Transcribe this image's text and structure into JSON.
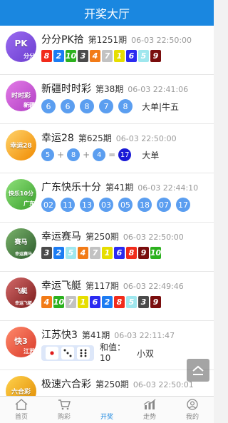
{
  "header": {
    "title": "开奖大厅"
  },
  "lotteries": [
    {
      "name": "分分PK拾",
      "issue": "第1251期",
      "time": "06-03 22:50:00",
      "logo": {
        "text": "PK",
        "badge": "分分",
        "color": "#7c4dd8"
      },
      "numbers": [
        "8",
        "2",
        "10",
        "3",
        "4",
        "7",
        "1",
        "6",
        "5",
        "9"
      ]
    },
    {
      "name": "新疆时时彩",
      "issue": "第38期",
      "time": "06-03 22:41:06",
      "logo": {
        "text": "时时彩",
        "badge": "新疆",
        "color": "#d25ad8"
      },
      "numbers": [
        "6",
        "6",
        "8",
        "7",
        "8"
      ],
      "result": "大单|牛五"
    },
    {
      "name": "幸运28",
      "issue": "第625期",
      "time": "06-03 22:50:00",
      "logo": {
        "text": "幸运28",
        "badge": "",
        "color": "#f0a020"
      },
      "numbers": [
        "5",
        "8",
        "4"
      ],
      "sum": "17",
      "result": "大单"
    },
    {
      "name": "广东快乐十分",
      "issue": "第41期",
      "time": "06-03 22:44:10",
      "logo": {
        "text": "快乐10分",
        "badge": "广东",
        "color": "#57c14b"
      },
      "numbers": [
        "02",
        "11",
        "13",
        "03",
        "05",
        "18",
        "07",
        "17"
      ]
    },
    {
      "name": "幸运赛马",
      "issue": "第250期",
      "time": "06-03 22:50:00",
      "logo": {
        "text": "赛马",
        "badge": "幸运赛马",
        "color": "#3a7f3a"
      },
      "numbers": [
        "3",
        "2",
        "5",
        "4",
        "7",
        "1",
        "6",
        "8",
        "9",
        "10"
      ]
    },
    {
      "name": "幸运飞艇",
      "issue": "第117期",
      "time": "06-03 22:49:46",
      "logo": {
        "text": "飞艇",
        "badge": "幸运飞艇",
        "color": "#b33"
      },
      "numbers": [
        "4",
        "10",
        "7",
        "1",
        "6",
        "2",
        "8",
        "5",
        "3",
        "9"
      ]
    },
    {
      "name": "江苏快3",
      "issue": "第41期",
      "time": "06-03 22:11:47",
      "logo": {
        "text": "快3",
        "badge": "江苏",
        "color": "#e94d3d"
      },
      "dice": [
        1,
        3,
        6
      ],
      "sum_label": "和值：10",
      "result": "小双"
    },
    {
      "name": "极速六合彩",
      "issue": "第250期",
      "time": "06-03 22:50:01",
      "logo": {
        "text": "六合彩",
        "badge": "",
        "color": "#f2a100"
      }
    }
  ],
  "tabbar": [
    {
      "label": "首页",
      "icon": "home-icon"
    },
    {
      "label": "购彩",
      "icon": "cart-icon"
    },
    {
      "label": "开奖",
      "icon": "award-icon"
    },
    {
      "label": "走势",
      "icon": "trend-icon"
    },
    {
      "label": "我的",
      "icon": "user-icon"
    }
  ],
  "colors": {
    "header": "#1a87e0",
    "ball": "#5b9ef0",
    "pk": {
      "1": "#e6de00",
      "2": "#1c7cf2",
      "3": "#4b4b4b",
      "4": "#f27b17",
      "5": "#9fe7ee",
      "6": "#2b2bf1",
      "7": "#c2c2c2",
      "8": "#f12b1b",
      "9": "#7a0d0d",
      "10": "#2cb11e"
    }
  }
}
